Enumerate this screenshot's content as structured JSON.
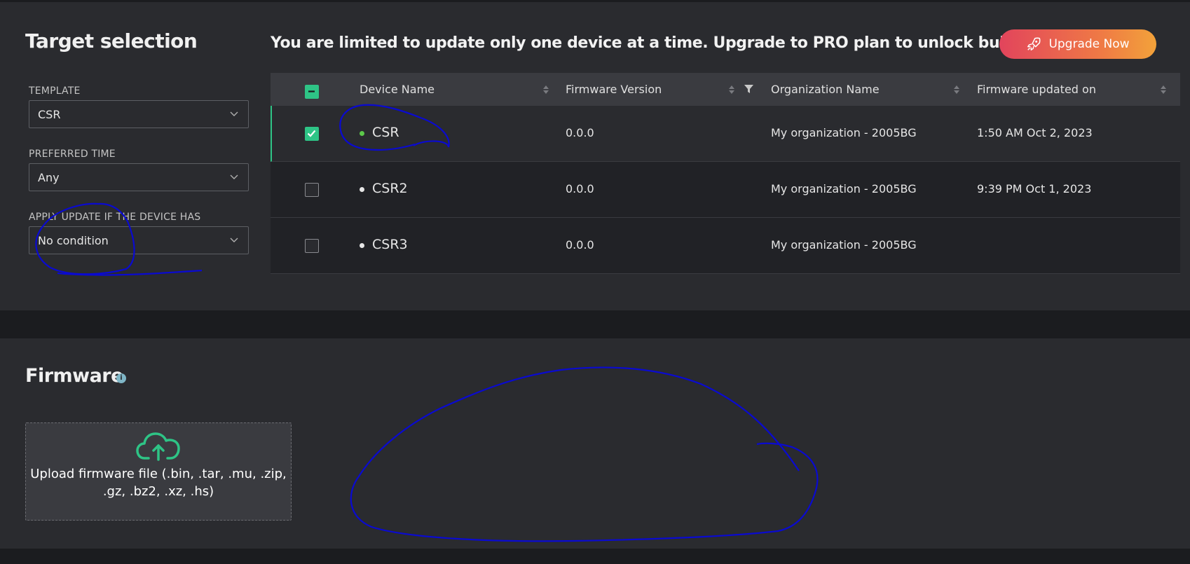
{
  "target_selection": {
    "title": "Target selection",
    "template": {
      "label": "TEMPLATE",
      "value": "CSR"
    },
    "preferred_time": {
      "label": "PREFERRED TIME",
      "value": "Any"
    },
    "apply_update": {
      "label": "APPLY UPDATE IF THE DEVICE HAS",
      "value": "No condition"
    }
  },
  "limit_notice": "You are limited to update only one device at a time. Upgrade to PRO plan to unlock bulk updates.",
  "upgrade_button": {
    "label": "Upgrade Now",
    "icon": "rocket-icon"
  },
  "table": {
    "columns": [
      "Device Name",
      "Firmware Version",
      "Organization Name",
      "Firmware updated on"
    ],
    "rows": [
      {
        "name": "CSR",
        "firmware": "0.0.0",
        "organization": "My organization - 2005BG",
        "updated": "1:50 AM Oct 2, 2023",
        "checked": true,
        "status_color": "#5cc84a"
      },
      {
        "name": "CSR2",
        "firmware": "0.0.0",
        "organization": "My organization - 2005BG",
        "updated": "9:39 PM Oct 1, 2023",
        "checked": false,
        "status_color": "#e6e6e6"
      },
      {
        "name": "CSR3",
        "firmware": "0.0.0",
        "organization": "My organization - 2005BG",
        "updated": "",
        "checked": false,
        "status_color": "#e6e6e6"
      }
    ]
  },
  "firmware": {
    "title": "Firmware",
    "upload_text": "Upload firmware file (.bin, .tar, .mu, .zip, .gz, .bz2, .xz, .hs)"
  },
  "colors": {
    "accent": "#2ec486",
    "annotation": "#0a0ad0",
    "background": "#2a2b2f"
  }
}
